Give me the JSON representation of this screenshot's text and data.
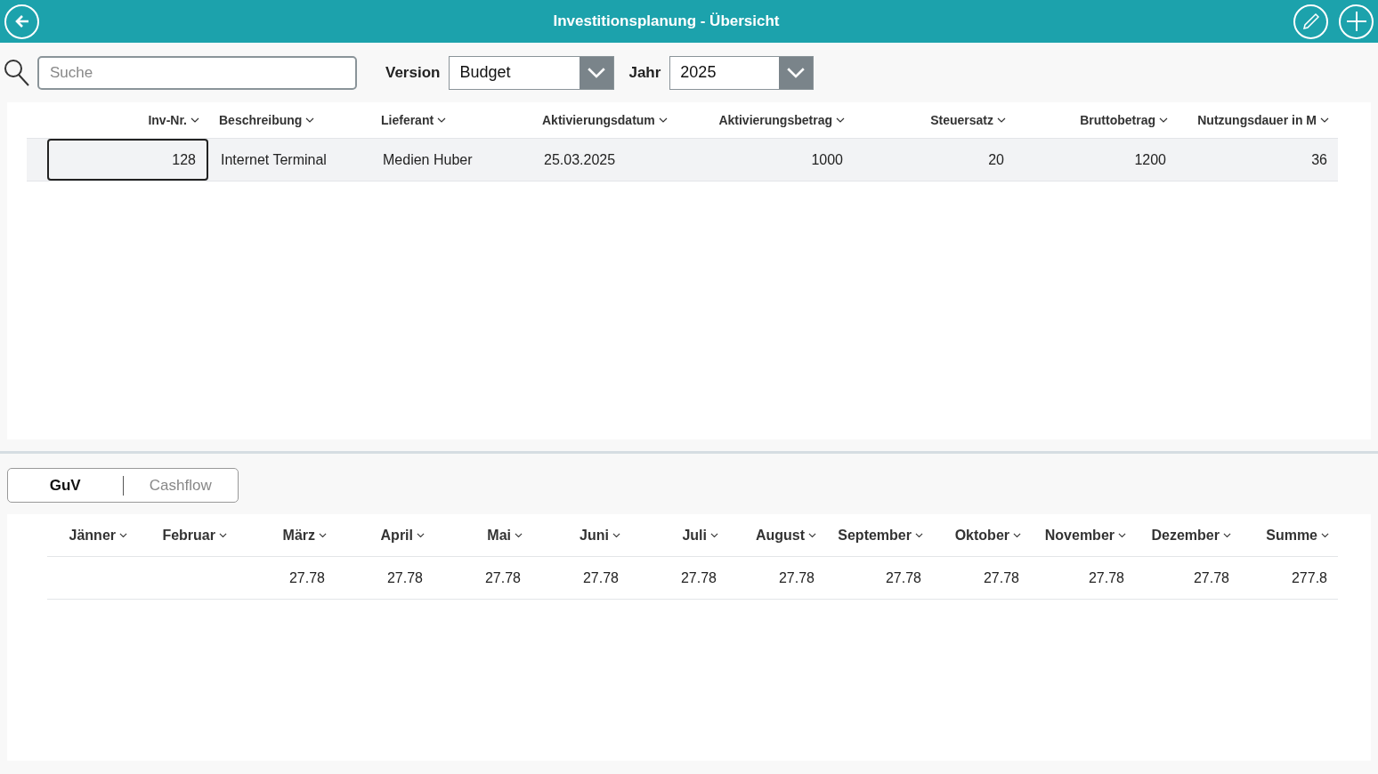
{
  "header": {
    "title": "Investitionsplanung - Übersicht"
  },
  "filters": {
    "search": {
      "placeholder": "Suche"
    },
    "version": {
      "label": "Version",
      "value": "Budget"
    },
    "year": {
      "label": "Jahr",
      "value": "2025"
    }
  },
  "investments": {
    "columns": [
      {
        "label": "Inv-Nr.",
        "kind": "number"
      },
      {
        "label": "Beschreibung",
        "kind": "text"
      },
      {
        "label": "Lieferant",
        "kind": "text"
      },
      {
        "label": "Aktivierungsdatum",
        "kind": "text"
      },
      {
        "label": "Aktivierungsbetrag",
        "kind": "number"
      },
      {
        "label": "Steuersatz",
        "kind": "number"
      },
      {
        "label": "Bruttobetrag",
        "kind": "number"
      },
      {
        "label": "Nutzungsdauer in M",
        "kind": "number"
      }
    ],
    "rows": [
      {
        "selected": true,
        "cells": [
          "128",
          "Internet Terminal",
          "Medien Huber",
          "25.03.2025",
          "1000",
          "20",
          "1200",
          "36"
        ]
      }
    ]
  },
  "view_tabs": [
    {
      "label": "GuV",
      "selected": true
    },
    {
      "label": "Cashflow",
      "selected": false
    }
  ],
  "months": {
    "columns": [
      "Jänner",
      "Februar",
      "März",
      "April",
      "Mai",
      "Juni",
      "Juli",
      "August",
      "September",
      "Oktober",
      "November",
      "Dezember",
      "Summe"
    ],
    "rows": [
      {
        "cells": [
          null,
          null,
          "27.78",
          "27.78",
          "27.78",
          "27.78",
          "27.78",
          "27.78",
          "27.78",
          "27.78",
          "27.78",
          "27.78",
          "277.8"
        ]
      }
    ]
  }
}
